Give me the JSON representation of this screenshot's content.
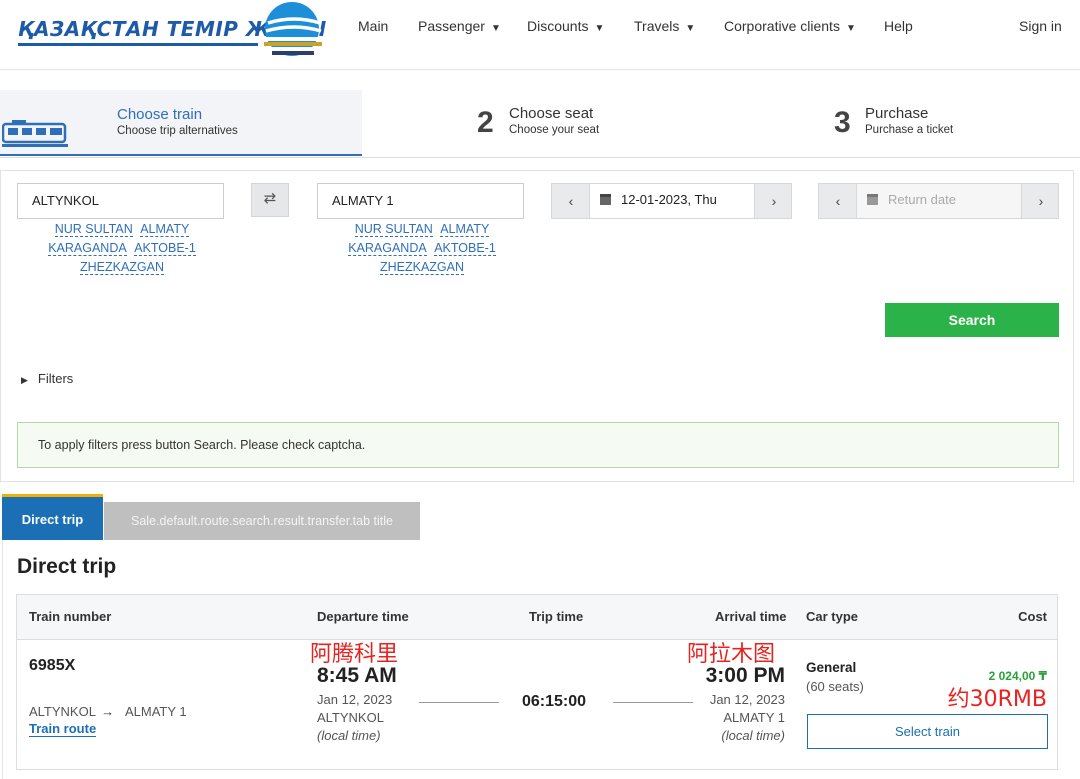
{
  "header": {
    "logo_text": "ҚАЗАҚСТАН ТЕМІР ЖОЛЫ",
    "nav": [
      {
        "label": "Main",
        "dropdown": false
      },
      {
        "label": "Passenger",
        "dropdown": true
      },
      {
        "label": "Discounts",
        "dropdown": true
      },
      {
        "label": "Travels",
        "dropdown": true
      },
      {
        "label": "Corporative clients",
        "dropdown": true
      },
      {
        "label": "Help",
        "dropdown": false
      }
    ],
    "sign_in": "Sign in"
  },
  "steps": [
    {
      "number": "",
      "title": "Choose train",
      "subtitle": "Choose trip alternatives",
      "active": true
    },
    {
      "number": "2",
      "title": "Choose seat",
      "subtitle": "Choose your seat",
      "active": false
    },
    {
      "number": "3",
      "title": "Purchase",
      "subtitle": "Purchase a ticket",
      "active": false
    }
  ],
  "search": {
    "from": "ALTYNKOL",
    "to": "ALMATY 1",
    "quick_from": [
      "NUR SULTAN",
      "ALMATY",
      "KARAGANDA",
      "AKTOBE-1",
      "ZHEZKAZGAN"
    ],
    "quick_to": [
      "NUR SULTAN",
      "ALMATY",
      "KARAGANDA",
      "AKTOBE-1",
      "ZHEZKAZGAN"
    ],
    "depart_date": "12-01-2023, Thu",
    "return_placeholder": "Return date",
    "search_label": "Search",
    "filters_label": "Filters",
    "notice": "To apply filters press button Search. Please check captcha."
  },
  "tabs": {
    "direct": "Direct trip",
    "transfer": "Sale.default.route.search.result.transfer.tab title"
  },
  "results": {
    "title": "Direct trip",
    "columns": [
      "Train number",
      "Departure time",
      "Trip time",
      "Arrival time",
      "Car type",
      "Cost"
    ],
    "row": {
      "train_number": "6985X",
      "route_from": "ALTYNKOL",
      "route_arrow": "→",
      "route_to": "ALMATY 1",
      "train_route_link": "Train route",
      "departure_time": "8:45 AM",
      "departure_date": "Jan 12, 2023",
      "departure_station": "ALTYNKOL",
      "local_time": "(local time)",
      "trip_time": "06:15:00",
      "arrival_time": "3:00 PM",
      "arrival_date": "Jan 12, 2023",
      "arrival_station": "ALMATY 1",
      "car_type": "General",
      "seats": "(60 seats)",
      "cost": "2 024,00 ₸",
      "select_label": "Select train"
    }
  },
  "annotations": {
    "departure_cn": "阿腾科里",
    "arrival_cn": "阿拉木图",
    "price_cn": "约30RMB",
    "color": "#e8231f"
  }
}
